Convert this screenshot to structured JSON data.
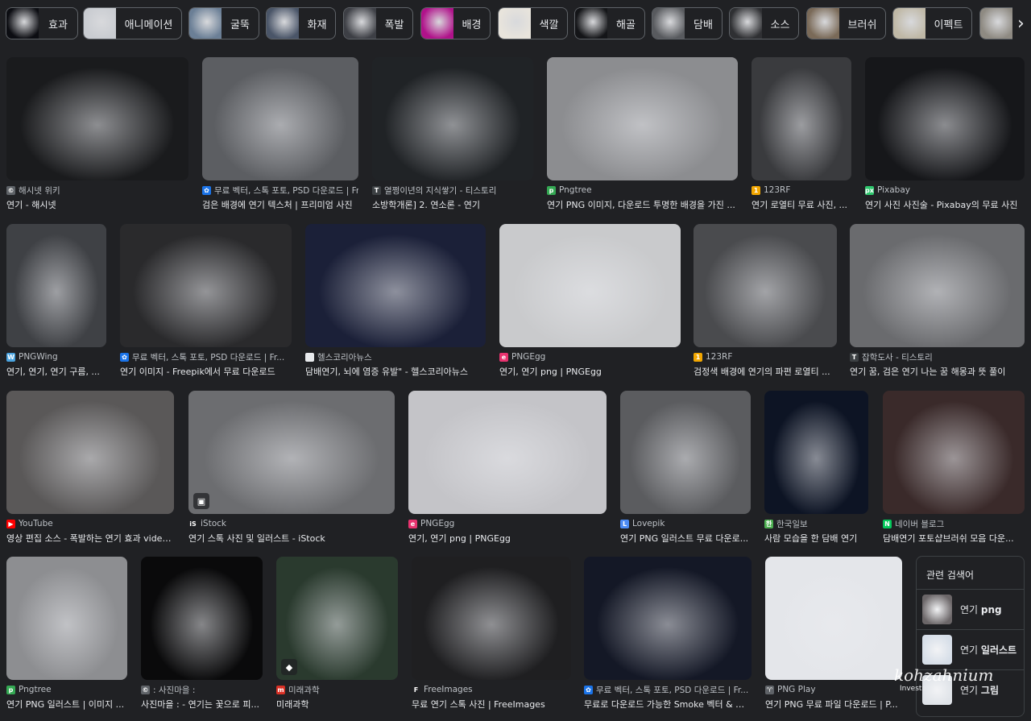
{
  "chips": [
    {
      "label": "효과",
      "swatch": "#0c0d12"
    },
    {
      "label": "애니메이션",
      "swatch": "#c9ccd1"
    },
    {
      "label": "굴뚝",
      "swatch": "#6b7f96"
    },
    {
      "label": "화재",
      "swatch": "#4a5568"
    },
    {
      "label": "폭발",
      "swatch": "#3d3f45"
    },
    {
      "label": "배경",
      "swatch": "#b0128a"
    },
    {
      "label": "색깔",
      "swatch": "#e8e4dc"
    },
    {
      "label": "해골",
      "swatch": "#141518"
    },
    {
      "label": "담배",
      "swatch": "#585a5e"
    },
    {
      "label": "소스",
      "swatch": "#2f3033"
    },
    {
      "label": "브러쉬",
      "swatch": "#7a6a58"
    },
    {
      "label": "이펙트",
      "swatch": "#bfb8a6"
    },
    {
      "label": "",
      "swatch": "#8e8a82"
    }
  ],
  "next_icon": "chevron-right-icon",
  "results": [
    {
      "source": "해시넷 위키",
      "title": "연기 - 해시넷",
      "fav_color": "#5f6368",
      "fav_glyph": "©",
      "img": "#1a1b1d"
    },
    {
      "source": "무료 벡터, 스톡 포토, PSD 다운로드 | Fr...",
      "title": "검은 배경에 연기 텍스처 | 프리미엄 사진",
      "fav_color": "#1a73e8",
      "fav_glyph": "✿",
      "img": "#5c5e62"
    },
    {
      "source": "열쩡이년의 지식쌓기 - 티스토리",
      "title": "소방학개론] 2. 연소론 - 연기",
      "fav_color": "#3c4043",
      "fav_glyph": "T",
      "img": "#202326"
    },
    {
      "source": "Pngtree",
      "title": "연기 PNG 이미지, 다운로드 투명한 배경을 가진 ...",
      "fav_color": "#34a853",
      "fav_glyph": "p",
      "img": "#8c8d90"
    },
    {
      "source": "123RF",
      "title": "연기 로열티 무료 사진, ...",
      "fav_color": "#f2a600",
      "fav_glyph": "1",
      "img": "#3a3b3e"
    },
    {
      "source": "Pixabay",
      "title": "연기 사진 사진술 - Pixabay의 무료 사진",
      "fav_color": "#2ec66d",
      "fav_glyph": "px",
      "img": "#16171a"
    },
    {
      "source": "PNGWing",
      "title": "연기, 연기, 연기 구름, ...",
      "fav_color": "#4aa3df",
      "fav_glyph": "W",
      "img": "#3f4145"
    },
    {
      "source": "무료 벡터, 스톡 포토, PSD 다운로드 | Fr...",
      "title": "연기 이미지 - Freepik에서 무료 다운로드",
      "fav_color": "#1a73e8",
      "fav_glyph": "✿",
      "img": "#2a2a2c"
    },
    {
      "source": "헬스코리아뉴스",
      "title": "담배연기, 뇌에 염증 유발\" - 헬스코리아뉴스",
      "fav_color": "#e8eaed",
      "fav_glyph": "",
      "img": "#1b2038"
    },
    {
      "source": "PNGEgg",
      "title": "연기, 연기 png | PNGEgg",
      "fav_color": "#e8336f",
      "fav_glyph": "e",
      "img": "#c9cacc"
    },
    {
      "source": "123RF",
      "title": "검정색 배경에 연기의 파편 로열티 ...",
      "fav_color": "#f2a600",
      "fav_glyph": "1",
      "img": "#4a4b4e"
    },
    {
      "source": "잡학도사 - 티스토리",
      "title": "연기 꿈, 검은 연기 나는 꿈 해몽과 뜻 풀이",
      "fav_color": "#3c4043",
      "fav_glyph": "T",
      "img": "#6a6b6e"
    },
    {
      "source": "YouTube",
      "title": "영상 편집 소스 - 폭발하는 연기 효과 video...",
      "fav_color": "#ff0000",
      "fav_glyph": "▶",
      "img": "#5a5858"
    },
    {
      "source": "iStock",
      "title": "연기 스톡 사진 및 일러스트 - iStock",
      "fav_color": "#202124",
      "fav_glyph": "iS",
      "img": "#6c6d70"
    },
    {
      "source": "PNGEgg",
      "title": "연기, 연기 png | PNGEgg",
      "fav_color": "#e8336f",
      "fav_glyph": "e",
      "img": "#c4c4c8"
    },
    {
      "source": "Lovepik",
      "title": "연기 PNG 일러스트 무료 다운로...",
      "fav_color": "#4c8bf5",
      "fav_glyph": "L",
      "img": "#5b5c5f"
    },
    {
      "source": "한국일보",
      "title": "사람 모습을 한 담배 연기",
      "fav_color": "#4caf50",
      "fav_glyph": "한",
      "img": "#0d1424"
    },
    {
      "source": "네이버 블로그",
      "title": "담배연기 포토샵브러쉬 모음 다운...",
      "fav_color": "#03c75a",
      "fav_glyph": "N",
      "img": "#3a2a2a"
    },
    {
      "source": "Pngtree",
      "title": "연기 PNG 일러스트 | 이미지 ...",
      "fav_color": "#34a853",
      "fav_glyph": "p",
      "img": "#8d8e91"
    },
    {
      "source": ": 사진마을 :",
      "title": "사진마을 : - 연기는 꽃으로 피...",
      "fav_color": "#5f6368",
      "fav_glyph": "©",
      "img": "#0a0a0b"
    },
    {
      "source": "미래과학",
      "title": "미래과학",
      "fav_color": "#d93025",
      "fav_glyph": "m",
      "img": "#2a3a2e"
    },
    {
      "source": "FreeImages",
      "title": "무료 연기 스톡 사진 | FreeImages",
      "fav_color": "#202124",
      "fav_glyph": "F",
      "img": "#1f1f21"
    },
    {
      "source": "무료 벡터, 스톡 포토, PSD 다운로드 | Fr...",
      "title": "무료로 다운로드 가능한 Smoke 벡터 & 일...",
      "fav_color": "#1a73e8",
      "fav_glyph": "✿",
      "img": "#141826"
    },
    {
      "source": "PNG Play",
      "title": "연기 PNG 무료 파일 다운로드 | P...",
      "fav_color": "#5f6368",
      "fav_glyph": "♈",
      "img": "#e4e6ea"
    }
  ],
  "related": {
    "heading": "관련 검색어",
    "items": [
      {
        "prefix": "연기 ",
        "bold": "png",
        "thumb": "#6b6668"
      },
      {
        "prefix": "연기 ",
        "bold": "일러스트",
        "thumb": "#d6dee8"
      },
      {
        "prefix": "연기 ",
        "bold": "그림",
        "thumb": "#dfe3e8"
      }
    ]
  },
  "watermark": {
    "text": "kohzahnium",
    "sub": "Investo"
  }
}
